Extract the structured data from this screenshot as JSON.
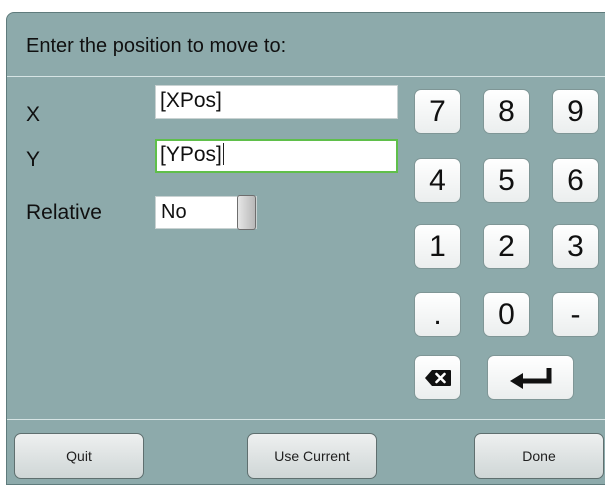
{
  "dialog": {
    "title": "Enter the position to move to:"
  },
  "fields": {
    "x": {
      "label": "X",
      "value": "[XPos]"
    },
    "y": {
      "label": "Y",
      "value": "[YPos]"
    },
    "relative": {
      "label": "Relative",
      "value": "No"
    }
  },
  "keypad": {
    "keys": [
      "7",
      "8",
      "9",
      "4",
      "5",
      "6",
      "1",
      "2",
      "3",
      ".",
      "0",
      "-"
    ],
    "backspace_icon": "backspace-icon",
    "enter_icon": "enter-arrow-icon"
  },
  "buttons": {
    "quit": "Quit",
    "use_current": "Use Current",
    "done": "Done"
  }
}
